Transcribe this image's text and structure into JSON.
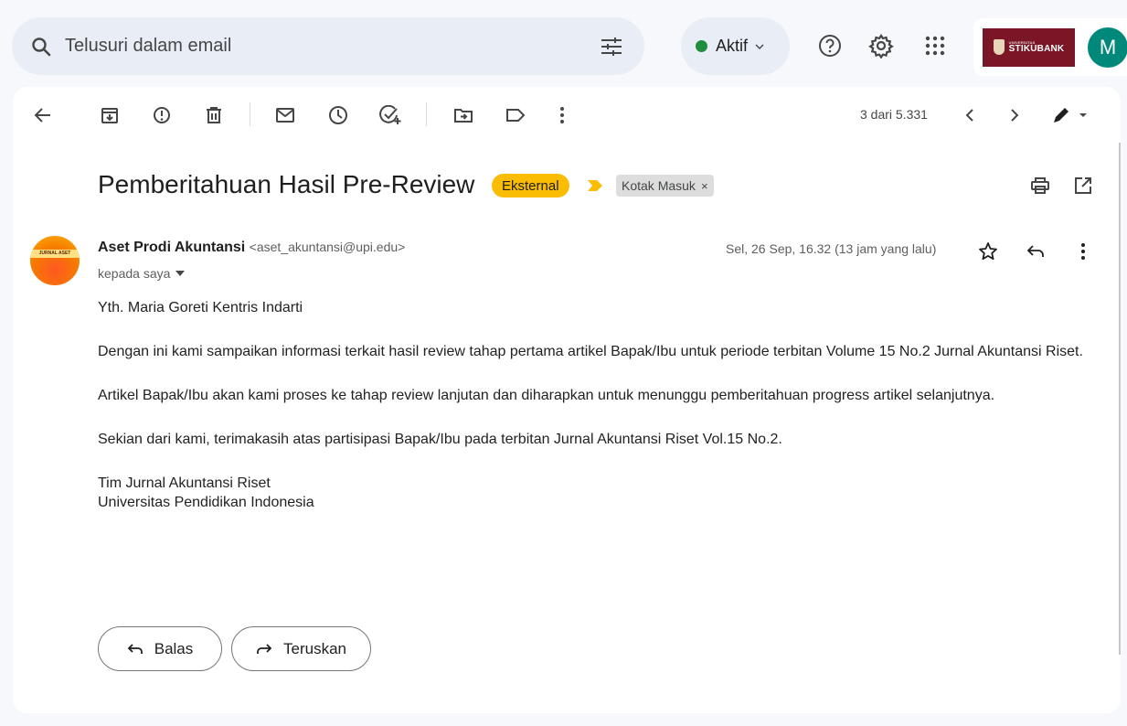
{
  "search": {
    "placeholder": "Telusuri dalam email",
    "icon": "search-icon",
    "filter_icon": "tune-icon"
  },
  "status": {
    "label": "Aktif",
    "color": "#1e8e3e"
  },
  "top_icons": [
    "help-icon",
    "settings-icon",
    "apps-icon"
  ],
  "account": {
    "org_logo_text": "STIKUBANK",
    "avatar_initial": "M",
    "avatar_color": "#00897b"
  },
  "toolbar": {
    "icons": [
      "back-icon",
      "archive-icon",
      "report-spam-icon",
      "delete-icon",
      "mark-unread-icon",
      "snooze-icon",
      "add-task-icon",
      "move-to-icon",
      "label-icon",
      "more-icon"
    ],
    "count": "3 dari 5.331",
    "nav": [
      "newer-icon",
      "older-icon",
      "input-tools-icon"
    ]
  },
  "email": {
    "subject": "Pemberitahuan Hasil Pre-Review",
    "badge": "Eksternal",
    "label": "Kotak Masuk",
    "label_remove": "×",
    "sender_name": "Aset Prodi Akuntansi",
    "sender_email": "<aset_akuntansi@upi.edu>",
    "sender_avatar_text": "JURNAL ASET",
    "to": "kepada saya",
    "date": "Sel, 26 Sep, 16.32 (13 jam yang lalu)",
    "body": [
      "Yth. Maria Goreti Kentris Indarti",
      "Dengan ini kami sampaikan informasi terkait hasil review tahap pertama artikel Bapak/Ibu untuk periode terbitan Volume 15 No.2 Jurnal Akuntansi Riset.",
      "Artikel Bapak/Ibu akan kami proses ke tahap review lanjutan dan diharapkan untuk menunggu pemberitahuan progress artikel selanjutnya.",
      "Sekian dari kami, terimakasih atas partisipasi Bapak/Ibu pada terbitan Jurnal Akuntansi Riset Vol.15 No.2."
    ],
    "signature": [
      "Tim Jurnal Akuntansi Riset",
      "Universitas Pendidikan Indonesia"
    ]
  },
  "actions": {
    "reply": "Balas",
    "forward": "Teruskan"
  },
  "colors": {
    "background": "#f6f8fc",
    "badge": "#fbbc04",
    "important": "#fbbc04"
  }
}
